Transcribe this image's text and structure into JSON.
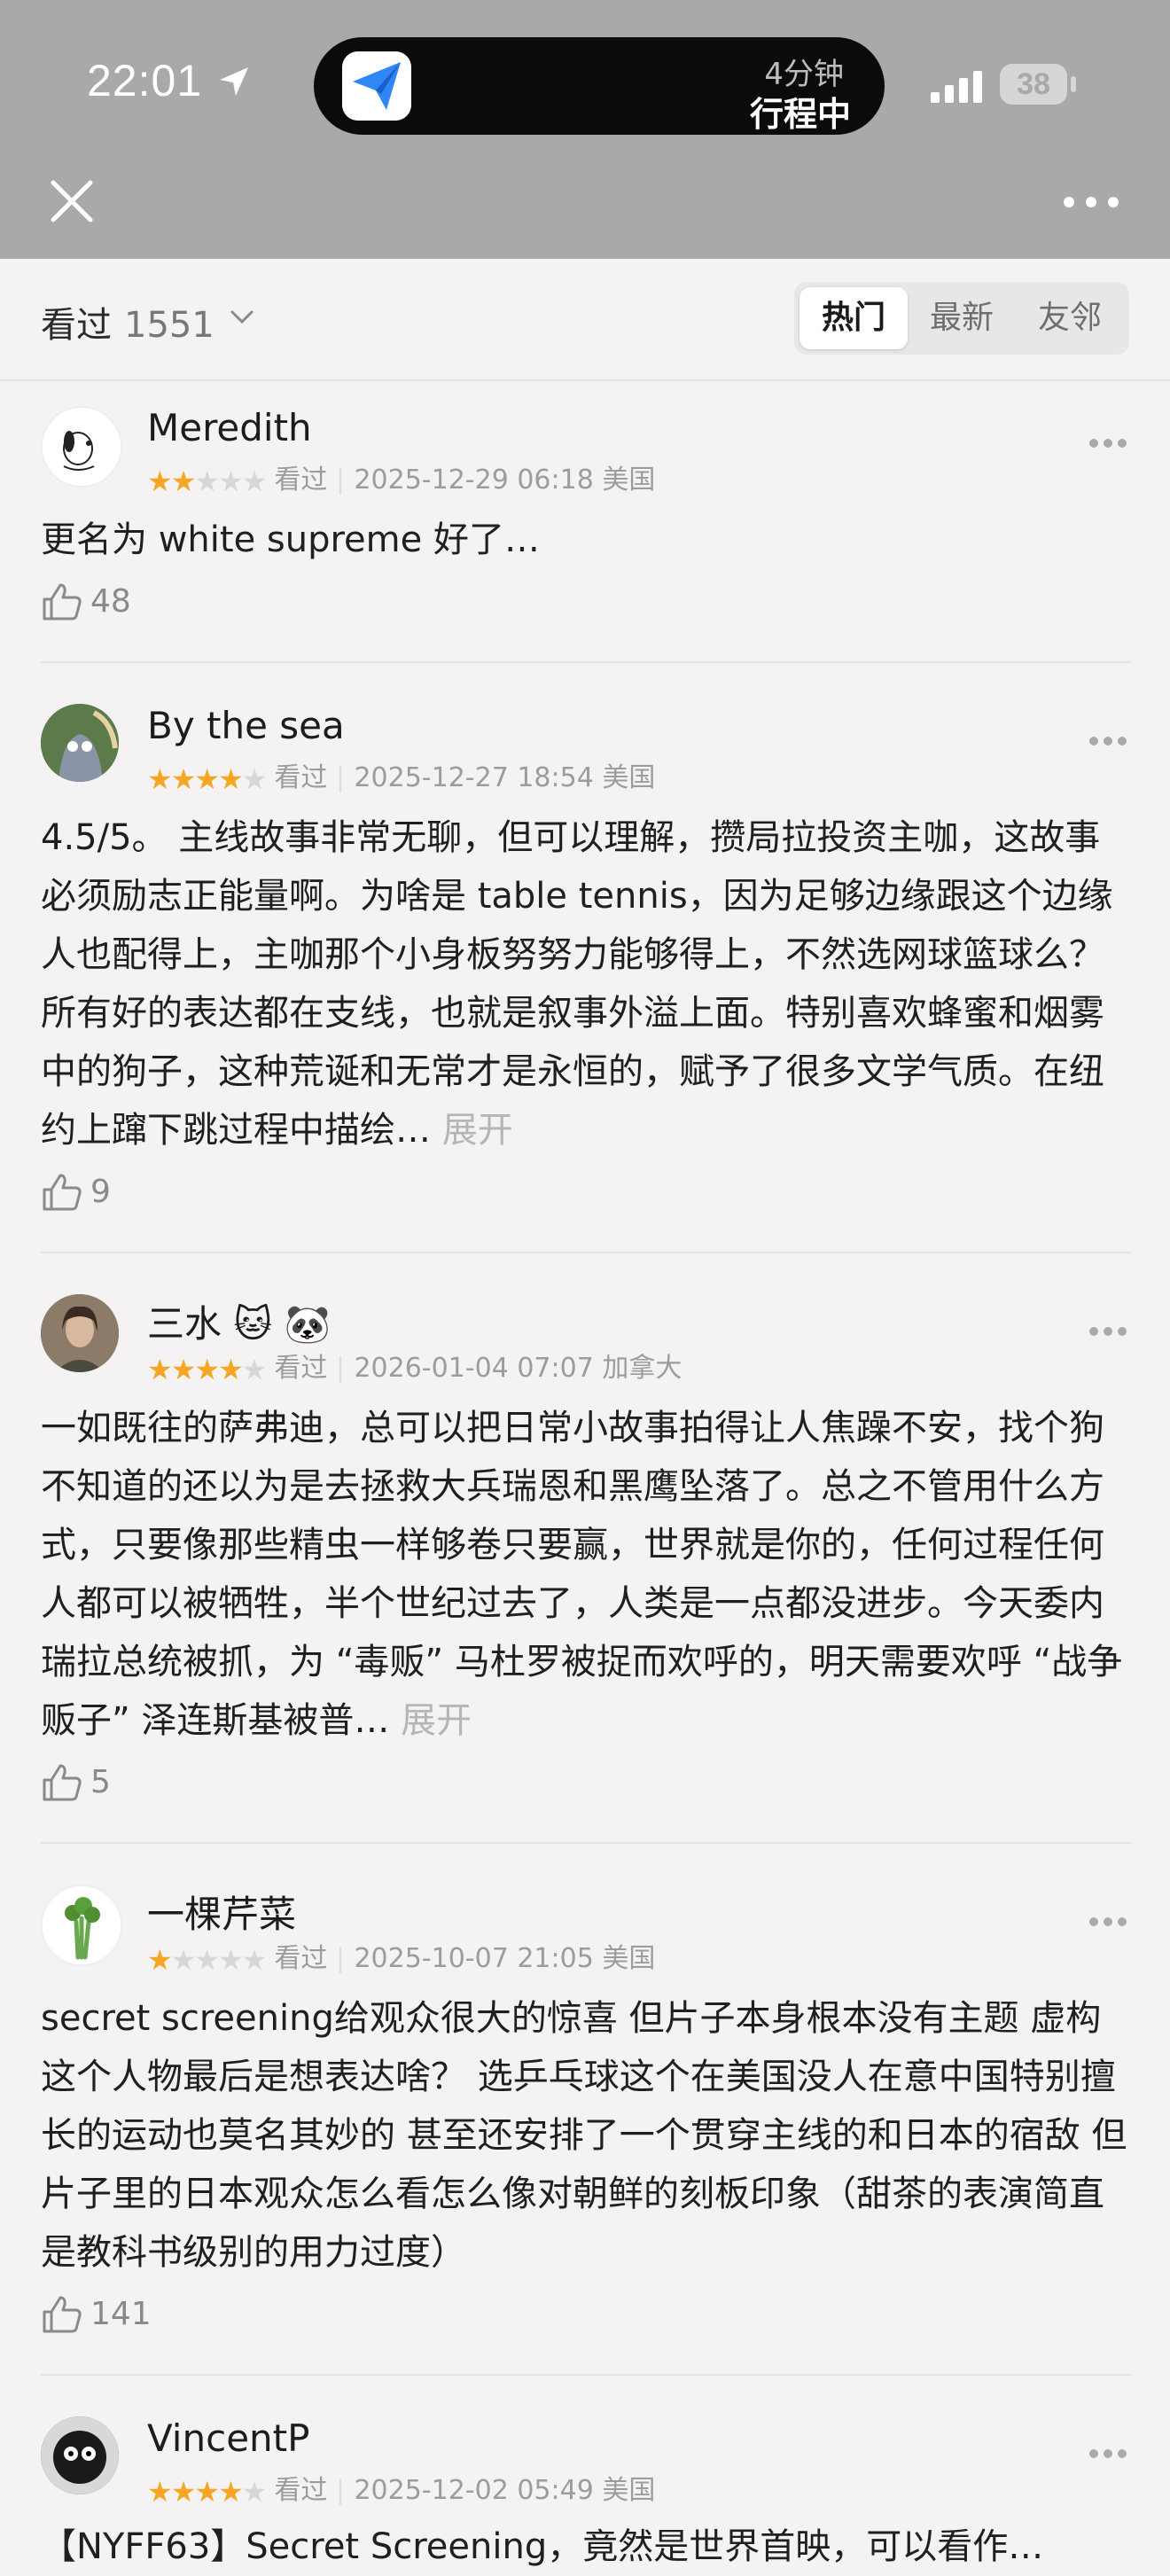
{
  "status_bar": {
    "time": "22:01",
    "island_line1": "4分钟",
    "island_line2": "行程中",
    "battery": "38"
  },
  "filter_bar": {
    "label": "看过",
    "count": "1551",
    "tabs": [
      "热门",
      "最新",
      "友邻"
    ],
    "active_tab": 0
  },
  "reviews": [
    {
      "user": "Meredith",
      "rating": 2,
      "status": "看过",
      "datetime": "2025-12-29 06:18",
      "location": "美国",
      "text": "更名为 white supreme 好了…",
      "expand": "",
      "likes": "48"
    },
    {
      "user": "By the sea",
      "rating": 4,
      "status": "看过",
      "datetime": "2025-12-27 18:54",
      "location": "美国",
      "text": "4.5/5。 主线故事非常无聊，但可以理解，攒局拉投资主咖，这故事必须励志正能量啊。为啥是 table tennis，因为足够边缘跟这个边缘人也配得上，主咖那个小身板努努力能够得上，不然选网球篮球么？ 所有好的表达都在支线，也就是叙事外溢上面。特别喜欢蜂蜜和烟雾中的狗子，这种荒诞和无常才是永恒的，赋予了很多文学气质。在纽约上蹿下跳过程中描绘…",
      "expand": "展开",
      "likes": "9"
    },
    {
      "user": "三水",
      "user_badges": "🐱 🐼",
      "rating": 4,
      "status": "看过",
      "datetime": "2026-01-04 07:07",
      "location": "加拿大",
      "text": "一如既往的萨弗迪，总可以把日常小故事拍得让人焦躁不安，找个狗不知道的还以为是去拯救大兵瑞恩和黑鹰坠落了。总之不管用什么方式，只要像那些精虫一样够卷只要赢，世界就是你的，任何过程任何人都可以被牺牲，半个世纪过去了，人类是一点都没进步。今天委内瑞拉总统被抓，为 “毒贩” 马杜罗被捉而欢呼的，明天需要欢呼 “战争贩子” 泽连斯基被普…",
      "expand": "展开",
      "likes": "5"
    },
    {
      "user": "一棵芹菜",
      "rating": 1,
      "status": "看过",
      "datetime": "2025-10-07 21:05",
      "location": "美国",
      "text": "secret screening给观众很大的惊喜 但片子本身根本没有主题 虚构这个人物最后是想表达啥？ 选乒乓球这个在美国没人在意中国特别擅长的运动也莫名其妙的 甚至还安排了一个贯穿主线的和日本的宿敌 但片子里的日本观众怎么看怎么像对朝鲜的刻板印象（甜茶的表演简直是教科书级别的用力过度）",
      "expand": "",
      "likes": "141"
    },
    {
      "user": "VincentP",
      "rating": 4,
      "status": "看过",
      "datetime": "2025-12-02 05:49",
      "location": "美国",
      "text": "【NYFF63】Secret Screening，竟然是世界首映，可以看作…",
      "expand": "",
      "likes": ""
    }
  ]
}
